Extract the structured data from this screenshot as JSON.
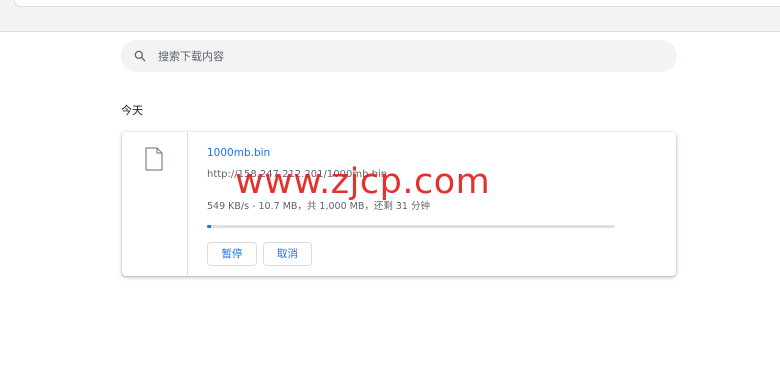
{
  "search": {
    "placeholder": "搜索下载内容"
  },
  "section": {
    "title": "今天"
  },
  "download": {
    "file_name": "1000mb.bin",
    "url": "http://158.247.212.201/1000mb.bin",
    "status": "549 KB/s - 10.7 MB，共 1,000 MB，还剩 31 分钟",
    "progress_fraction": 0.011,
    "pause_label": "暂停",
    "cancel_label": "取消"
  },
  "watermark": {
    "text": "www.zjcp.com"
  },
  "colors": {
    "accent": "#1a73e8",
    "watermark": "#e0211d",
    "search_bg": "#f1f3f4"
  }
}
